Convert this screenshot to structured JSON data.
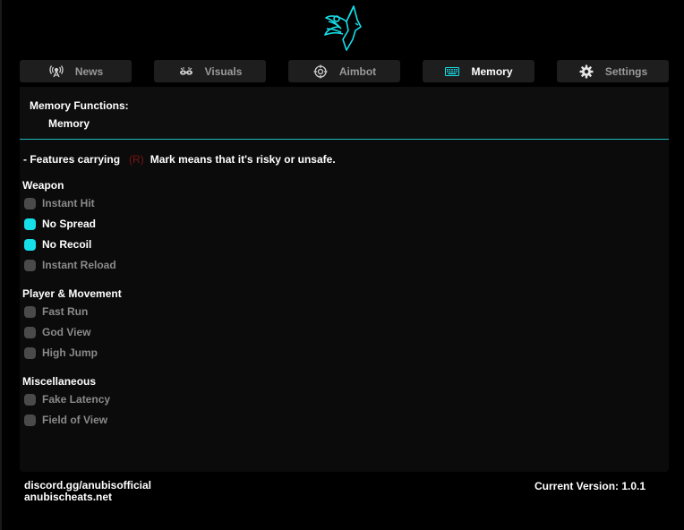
{
  "colors": {
    "accent": "#15e0ea",
    "risk": "#7a1515",
    "tab_bg": "#1e1e1e",
    "panel_bg": "#0b0b0b"
  },
  "tabs": [
    {
      "label": "News",
      "icon": "antenna-icon",
      "active": false
    },
    {
      "label": "Visuals",
      "icon": "eyes-icon",
      "active": false
    },
    {
      "label": "Aimbot",
      "icon": "crosshair-icon",
      "active": false
    },
    {
      "label": "Memory",
      "icon": "keyboard-icon",
      "active": true
    },
    {
      "label": "Settings",
      "icon": "gear-icon",
      "active": false
    }
  ],
  "header": {
    "title": "Memory Functions:",
    "subtitle": "Memory"
  },
  "note": {
    "prefix": "- Features carrying",
    "mark": "(R)",
    "suffix": "Mark means that it's risky or unsafe."
  },
  "sections": [
    {
      "title": "Weapon",
      "options": [
        {
          "label": "Instant Hit",
          "checked": false
        },
        {
          "label": "No Spread",
          "checked": true
        },
        {
          "label": "No Recoil",
          "checked": true
        },
        {
          "label": "Instant Reload",
          "checked": false
        }
      ]
    },
    {
      "title": "Player & Movement",
      "options": [
        {
          "label": "Fast Run",
          "checked": false
        },
        {
          "label": "God View",
          "checked": false
        },
        {
          "label": "High Jump",
          "checked": false
        }
      ]
    },
    {
      "title": "Miscellaneous",
      "options": [
        {
          "label": "Fake Latency",
          "checked": false
        },
        {
          "label": "Field of View",
          "checked": false
        }
      ]
    }
  ],
  "footer": {
    "discord": "discord.gg/anubisofficial",
    "website": "anubischeats.net",
    "version": "Current Version: 1.0.1"
  }
}
